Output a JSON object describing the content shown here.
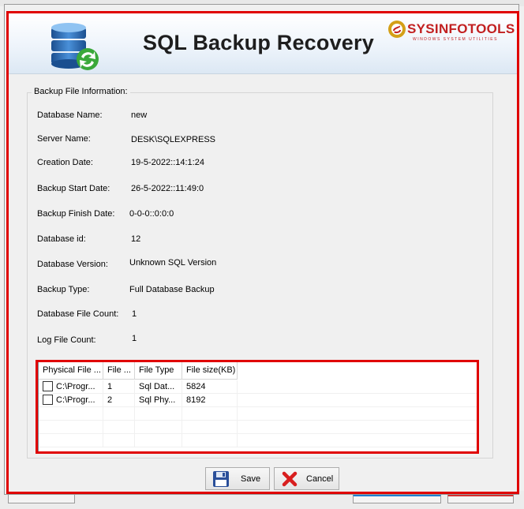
{
  "window": {
    "title": "SQL Backup Recovery",
    "brand": "SYSINFOTOOLS",
    "brand_tagline": "WINDOWS SYSTEM UTILITIES"
  },
  "backup_info": {
    "legend": "Backup File Information:",
    "fields": [
      {
        "label": "Database Name:",
        "value": "new"
      },
      {
        "label": "Server Name:",
        "value": "DESK\\SQLEXPRESS"
      },
      {
        "label": "Creation Date:",
        "value": "19-5-2022::14:1:24"
      },
      {
        "label": "Backup Start Date:",
        "value": "26-5-2022::11:49:0"
      },
      {
        "label": "Backup Finish Date:",
        "value": "0-0-0::0:0:0"
      },
      {
        "label": "Database id:",
        "value": "12"
      },
      {
        "label": "Database Version:",
        "value": "Unknown SQL Version"
      },
      {
        "label": "Backup Type:",
        "value": "Full Database Backup"
      },
      {
        "label": "Database File Count:",
        "value": "1"
      },
      {
        "label": "Log File Count:",
        "value": "1"
      }
    ]
  },
  "file_table": {
    "headers": [
      "Physical File ...",
      "File ...",
      "File Type",
      "File size(KB)"
    ],
    "rows": [
      [
        "C:\\Progr...",
        "1",
        "Sql Dat...",
        "5824"
      ],
      [
        "C:\\Progr...",
        "2",
        "Sql Phy...",
        "8192"
      ]
    ]
  },
  "buttons": {
    "save": "Save",
    "cancel": "Cancel"
  },
  "colors": {
    "highlight": "#e00000",
    "brand": "#c22020"
  }
}
